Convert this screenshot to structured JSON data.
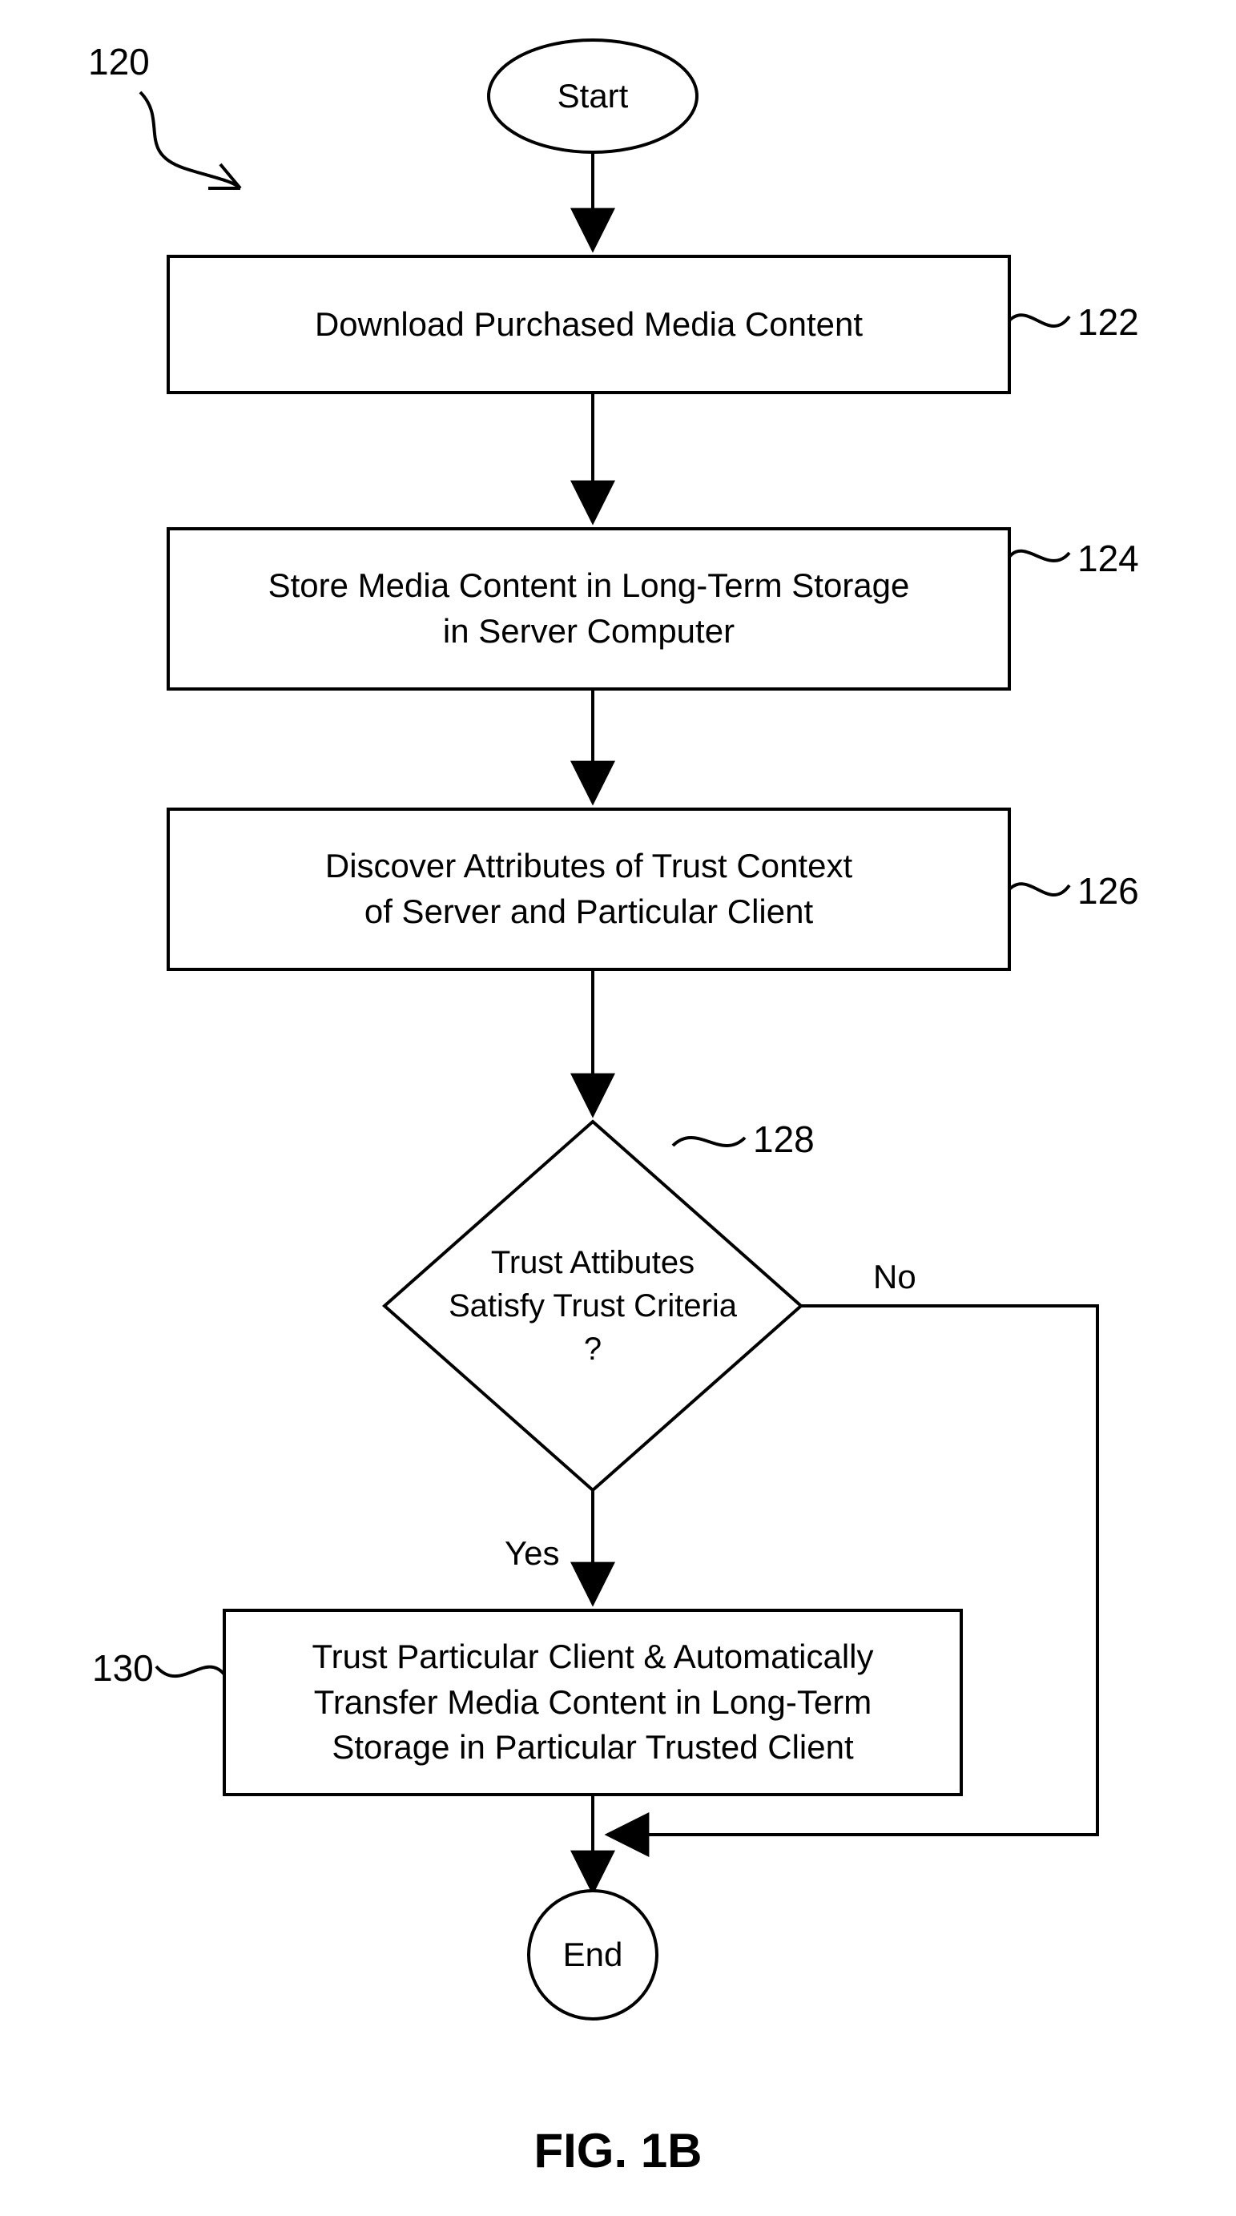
{
  "chart_data": {
    "type": "flowchart",
    "title": "FIG. 1B",
    "reference_numeral_overall": "120",
    "nodes": [
      {
        "id": "start",
        "shape": "terminator",
        "label": "Start"
      },
      {
        "id": "n122",
        "shape": "process",
        "ref": "122",
        "label": "Download Purchased Media Content"
      },
      {
        "id": "n124",
        "shape": "process",
        "ref": "124",
        "label": "Store Media Content in Long-Term Storage\nin Server Computer"
      },
      {
        "id": "n126",
        "shape": "process",
        "ref": "126",
        "label": "Discover Attributes of Trust Context\nof Server and Particular Client"
      },
      {
        "id": "n128",
        "shape": "decision",
        "ref": "128",
        "label": "Trust Attibutes\nSatisfy Trust Criteria\n?"
      },
      {
        "id": "n130",
        "shape": "process",
        "ref": "130",
        "label": "Trust Particular Client & Automatically\nTransfer Media Content in Long-Term\nStorage in Particular Trusted Client"
      },
      {
        "id": "end",
        "shape": "terminator",
        "label": "End"
      }
    ],
    "edges": [
      {
        "from": "start",
        "to": "n122",
        "label": ""
      },
      {
        "from": "n122",
        "to": "n124",
        "label": ""
      },
      {
        "from": "n124",
        "to": "n126",
        "label": ""
      },
      {
        "from": "n126",
        "to": "n128",
        "label": ""
      },
      {
        "from": "n128",
        "to": "n130",
        "label": "Yes"
      },
      {
        "from": "n128",
        "to": "end",
        "label": "No",
        "route": "right-down-left"
      },
      {
        "from": "n130",
        "to": "end",
        "label": ""
      }
    ]
  },
  "edge_labels": {
    "yes": "Yes",
    "no": "No"
  },
  "figure_title": "FIG. 1B"
}
